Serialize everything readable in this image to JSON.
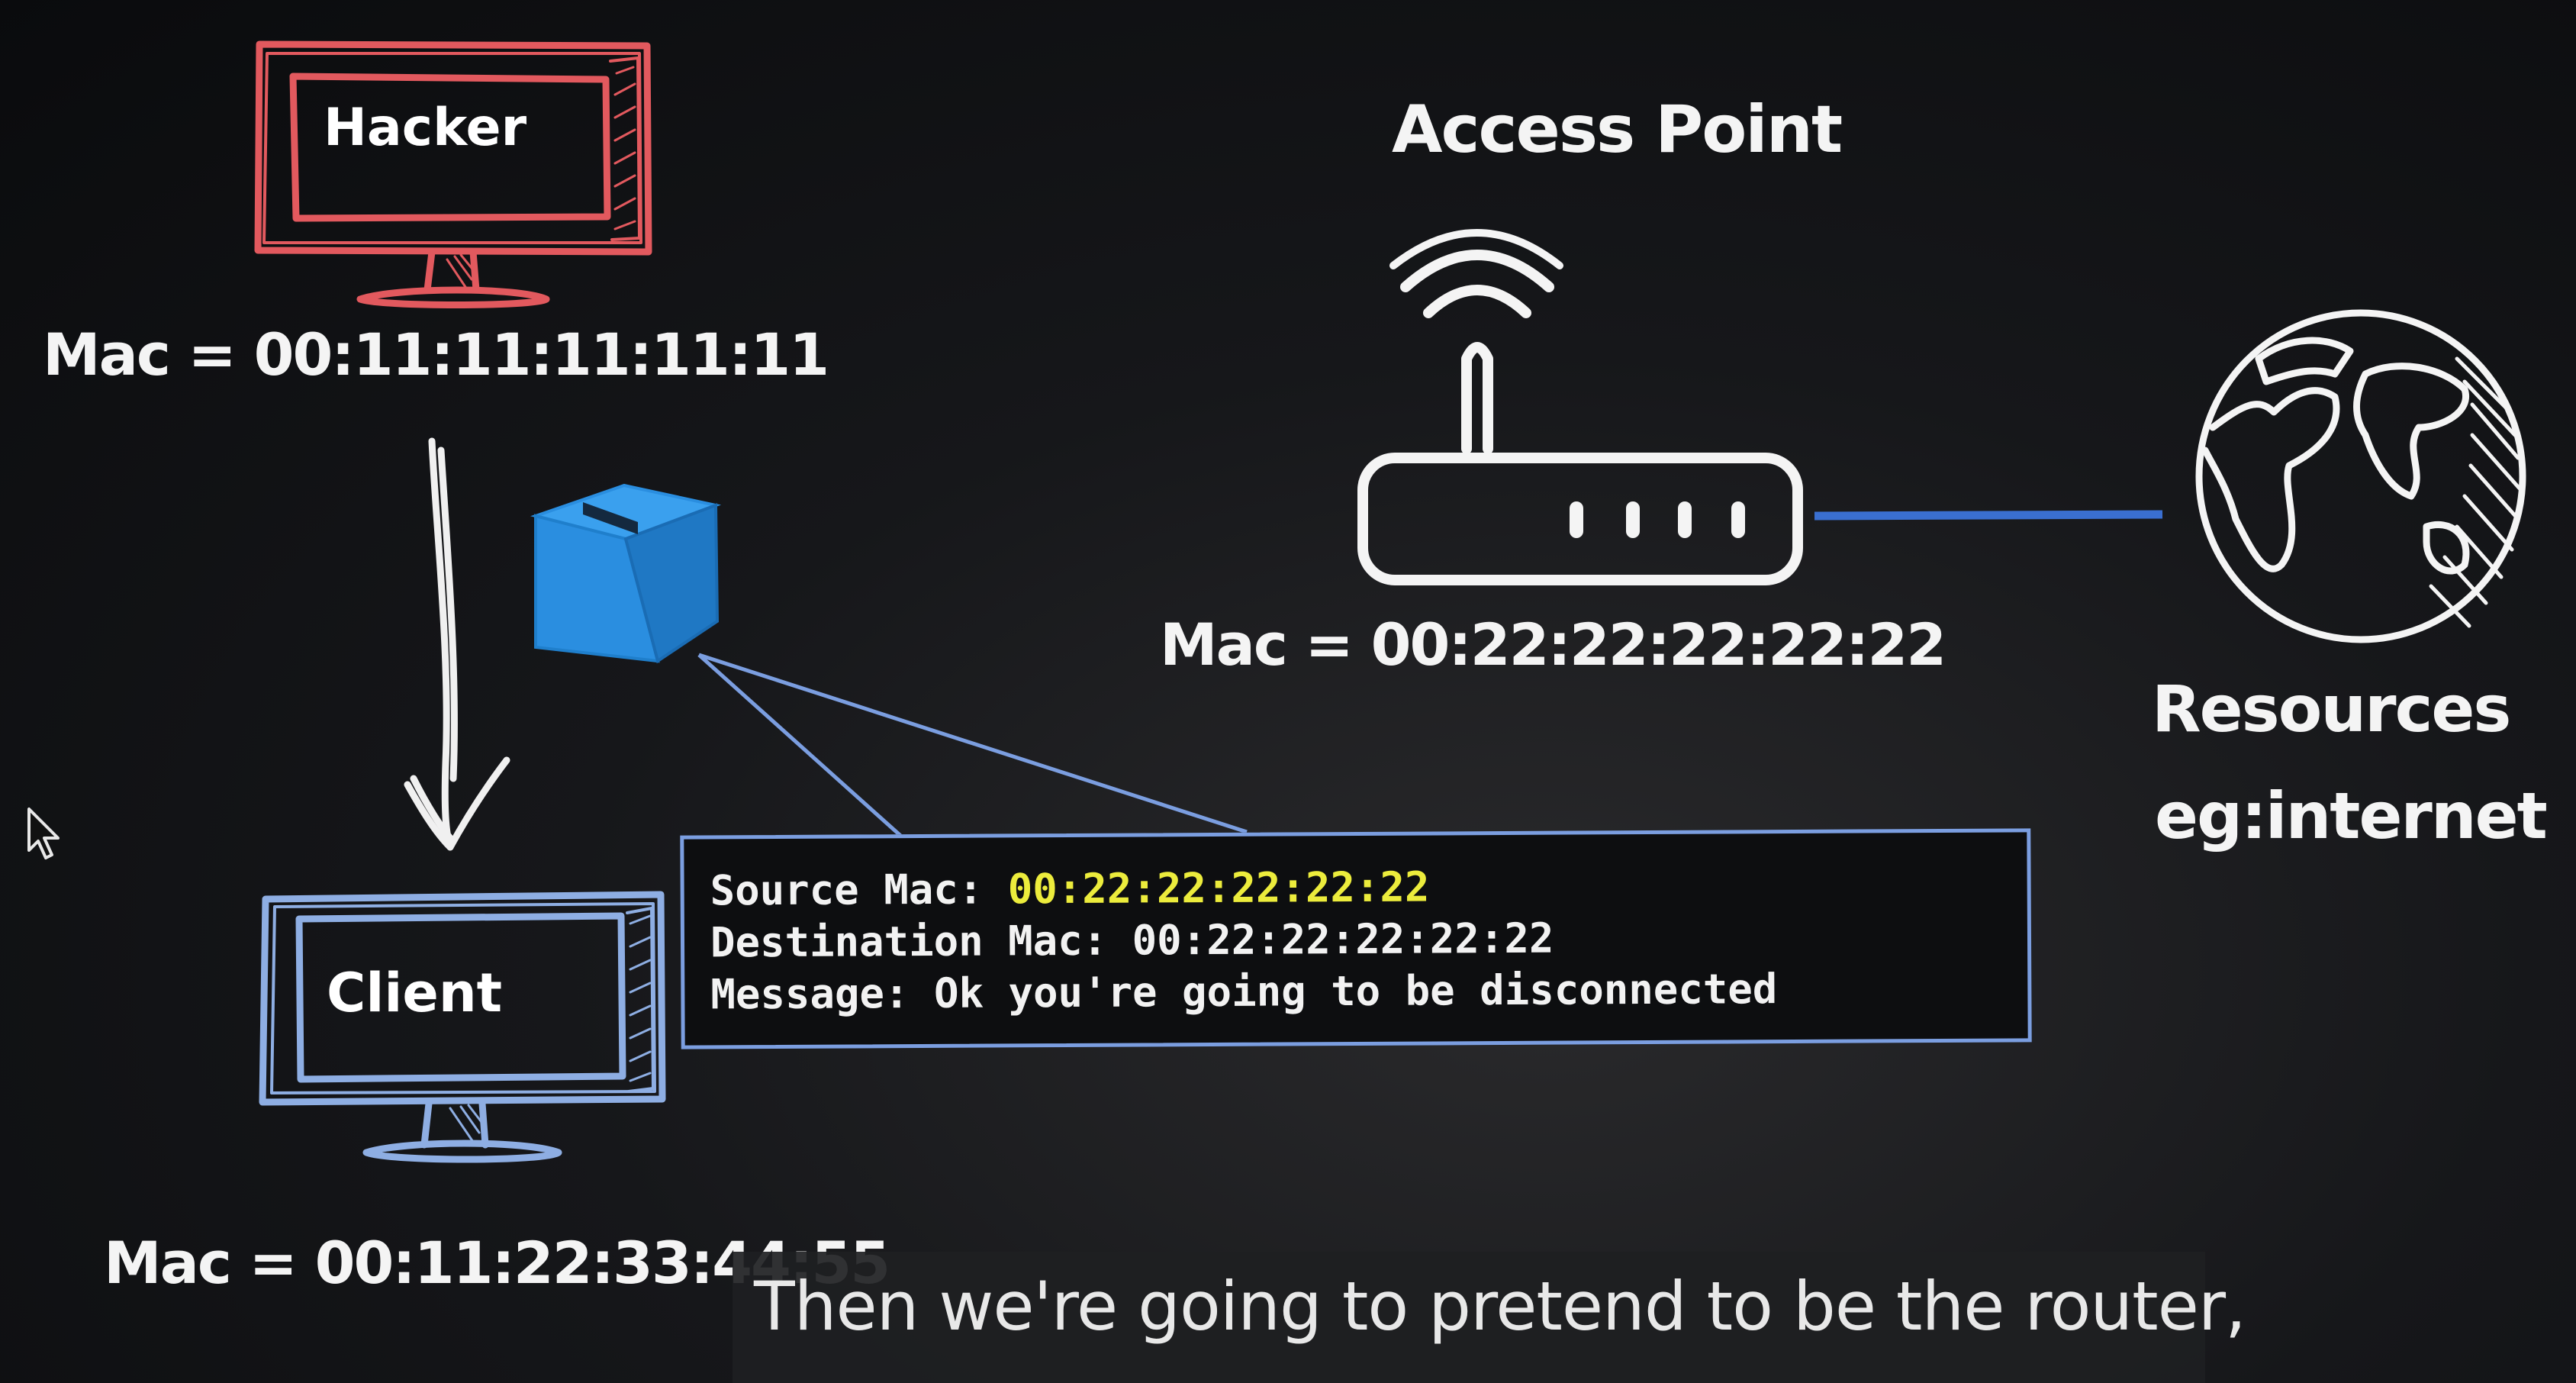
{
  "hacker": {
    "screen_label": "Hacker",
    "mac_label": "Mac = 00:11:11:11:11:11",
    "color": "#e2595e"
  },
  "access_point": {
    "title": "Access Point",
    "mac_label": "Mac = 00:22:22:22:22:22",
    "color": "#ffffff"
  },
  "client": {
    "screen_label": "Client",
    "mac_label": "Mac = 00:11:22:33:44:55",
    "color": "#8eaee3"
  },
  "resources": {
    "title": "Resources",
    "subtitle": "eg:internet"
  },
  "packet": {
    "icon": "package-icon",
    "color": "#2a8ee0",
    "source_mac_label": "Source Mac:",
    "source_mac_value": "00:22:22:22:22:22",
    "destination_mac_label": "Destination Mac:",
    "destination_mac_value": "00:22:22:22:22:22",
    "message_label": "Message:",
    "message_value": "Ok you're going to be disconnected",
    "highlight_color": "#ecec3c"
  },
  "link": {
    "color": "#3a6fd0"
  },
  "caption": {
    "text": "Then we're going to pretend to be the router,"
  }
}
